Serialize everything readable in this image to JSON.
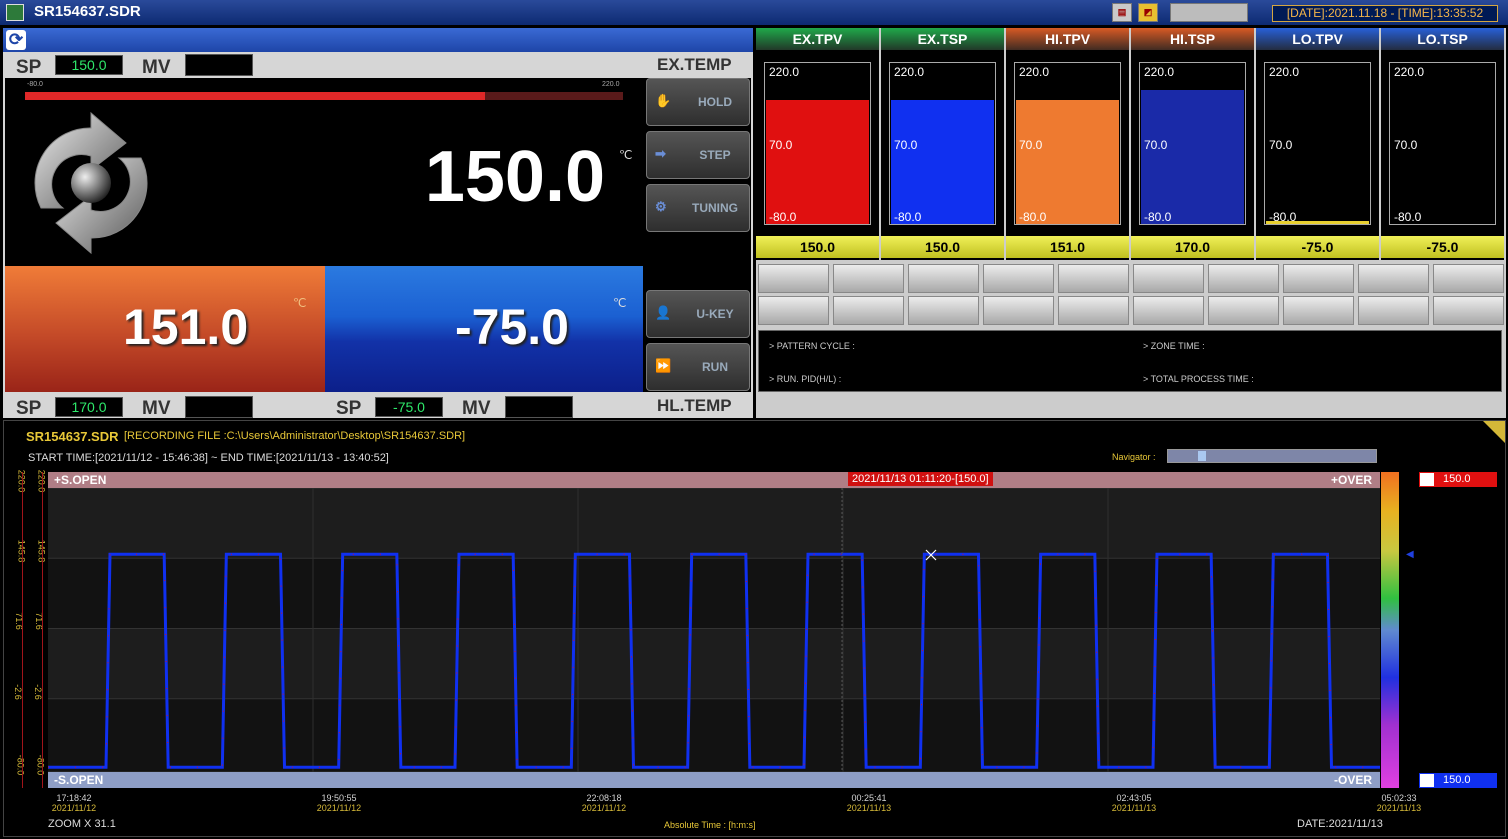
{
  "window": {
    "title": "SR154637.SDR",
    "datetime": "[DATE]:2021.11.18 - [TIME]:13:35:52"
  },
  "top_panel": {
    "ex": {
      "label": "EX.TEMP",
      "sp_label": "SP",
      "sp_value": "150.0",
      "mv_label": "MV",
      "mv_value": "",
      "pv": "150.0",
      "unit": "℃",
      "bar_min": "-80.0",
      "bar_max": "220.0",
      "bar_fill_fraction": 0.77
    },
    "hl": {
      "label": "HL.TEMP",
      "hi_pv": "151.0",
      "lo_pv": "-75.0",
      "unit": "℃",
      "hi_sp_label": "SP",
      "hi_sp_value": "170.0",
      "hi_mv_label": "MV",
      "lo_sp_label": "SP",
      "lo_sp_value": "-75.0",
      "lo_mv_label": "MV"
    },
    "buttons": [
      "HOLD",
      "STEP",
      "TUNING",
      "U-KEY",
      "RUN"
    ]
  },
  "gauges": [
    {
      "name": "EX.TPV",
      "value": "150.0",
      "fill": 0.77,
      "head_color": "#1fa94a",
      "fill_color": "#e01010"
    },
    {
      "name": "EX.TSP",
      "value": "150.0",
      "fill": 0.77,
      "head_color": "#1fa94a",
      "fill_color": "#1030f0"
    },
    {
      "name": "HI.TPV",
      "value": "151.0",
      "fill": 0.77,
      "head_color": "#d85a24",
      "fill_color": "#ee7a30"
    },
    {
      "name": "HI.TSP",
      "value": "170.0",
      "fill": 0.83,
      "head_color": "#d85a24",
      "fill_color": "#1a2aa8"
    },
    {
      "name": "LO.TPV",
      "value": "-75.0",
      "fill": 0.02,
      "head_color": "#2860d8",
      "fill_color": "#e8d030"
    },
    {
      "name": "LO.TSP",
      "value": "-75.0",
      "fill": 0.0,
      "head_color": "#2860d8",
      "fill_color": "#1030f0"
    }
  ],
  "gauge_scale": {
    "top": "220.0",
    "mid": "70.0",
    "bottom": "-80.0"
  },
  "info": {
    "pattern_cycle": "> PATTERN CYCLE :",
    "zone_time": "> ZONE TIME :",
    "run_pid": "> RUN. PID(H/L) :",
    "total_time": "> TOTAL PROCESS TIME :"
  },
  "trend": {
    "file_name": "SR154637.SDR",
    "recording": "[RECORDING FILE :C:\\Users\\Administrator\\Desktop\\SR154637.SDR]",
    "time_range": "START TIME:[2021/11/12 - 15:46:38] ~ END TIME:[2021/11/13 - 13:40:52]",
    "navigator": "Navigator :",
    "top_left": "+S.OPEN",
    "top_right": "+OVER",
    "bottom_left": "-S.OPEN",
    "bottom_right": "-OVER",
    "cursor": "2021/11/13 01:11:20-[150.0]",
    "legend": [
      "150.0",
      "150.0"
    ],
    "zoom": "ZOOM X 31.1",
    "axis_unit": "Absolute Time : [h:m:s]",
    "date": "DATE:2021/11/13",
    "y_ticks": [
      "220.0",
      "145.8",
      "71.6",
      "-2.6",
      "-80.0"
    ],
    "x_ticks": [
      {
        "t": "17:18:42",
        "d": "2021/11/12"
      },
      {
        "t": "19:50:55",
        "d": "2021/11/12"
      },
      {
        "t": "22:08:18",
        "d": "2021/11/12"
      },
      {
        "t": "00:25:41",
        "d": "2021/11/13"
      },
      {
        "t": "02:43:05",
        "d": "2021/11/13"
      },
      {
        "t": "05:02:33",
        "d": "2021/11/13"
      }
    ]
  },
  "chart_data": {
    "type": "line",
    "ylim": [
      -80,
      220
    ],
    "y_ticks": [
      220.0,
      145.8,
      71.6,
      -2.6,
      -80.0
    ],
    "series": [
      {
        "name": "150.0",
        "color": "#e01010",
        "pattern": {
          "high": 150.0,
          "low": -75.0,
          "cycles": 11
        }
      },
      {
        "name": "150.0",
        "color": "#1030f0",
        "pattern": {
          "high": 150.0,
          "low": -75.0,
          "cycles": 11
        }
      }
    ]
  }
}
